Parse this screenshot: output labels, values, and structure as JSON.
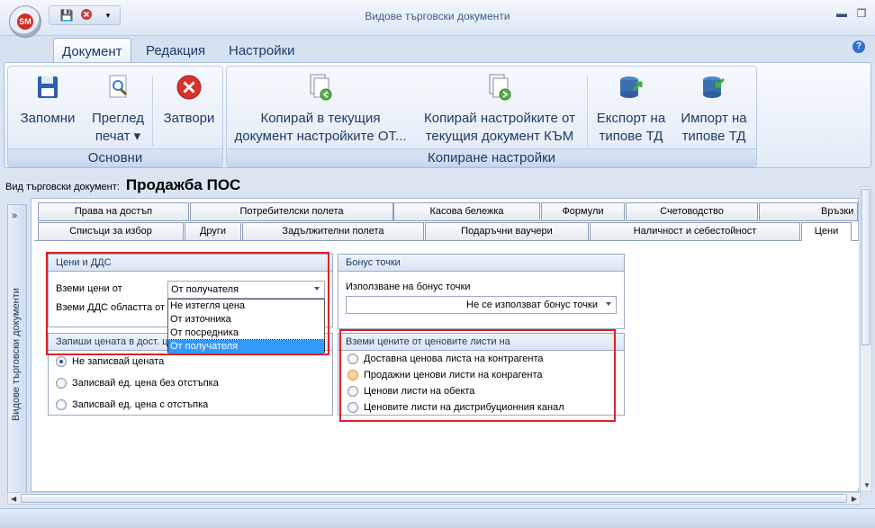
{
  "window": {
    "title": "Видове търговски документи",
    "app_badge": "SM",
    "colors": {
      "accent": "#d42a24",
      "highlight_red": "#e21f26",
      "selection": "#3399ff"
    }
  },
  "qat": {
    "save_icon": "floppy-disk-icon",
    "close_icon": "red-x-icon",
    "more": "▾"
  },
  "window_controls": {
    "minimize": "▬",
    "restore": "❐"
  },
  "ribbon_tabs": [
    {
      "label": "Документ",
      "active": true
    },
    {
      "label": "Редакция",
      "active": false
    },
    {
      "label": "Настройки",
      "active": false
    }
  ],
  "help": "?",
  "ribbon": {
    "groups": [
      {
        "label": "Основни",
        "buttons": [
          {
            "line1": "Запомни",
            "line2": "",
            "icon": "floppy-disk-icon"
          },
          {
            "line1": "Преглед",
            "line2": "печат ▾",
            "icon": "print-preview-icon"
          },
          {
            "line1": "Затвори",
            "line2": "",
            "icon": "red-x-circle-icon"
          }
        ]
      },
      {
        "label": "Копиране настройки",
        "buttons": [
          {
            "line1": "Копирай в текущия",
            "line2": "документ настройките ОТ...",
            "icon": "copy-from-icon"
          },
          {
            "line1": "Копирай настройките от",
            "line2": "текущия документ КЪМ",
            "icon": "copy-to-icon"
          },
          {
            "line1": "Експорт на",
            "line2": "типове ТД",
            "icon": "database-export-icon"
          },
          {
            "line1": "Импорт на",
            "line2": "типове ТД",
            "icon": "database-import-icon"
          }
        ]
      }
    ]
  },
  "doc_type": {
    "label": "Вид търговски документ:",
    "value": "Продажба ПОС"
  },
  "side_panel": {
    "chevron": "»",
    "label": "Видове търговски документи"
  },
  "tabs_row1": [
    "Права на достъп",
    "Потребителски полета",
    "Касова бележка",
    "Формули",
    "Счетоводство",
    "Връзки с"
  ],
  "tabs_row2": [
    "Списъци за избор",
    "Други",
    "Задължителни полета",
    "Подаръчни ваучери",
    "Наличност и себестойност",
    "Цени"
  ],
  "prices_vat": {
    "header": "Цени и ДДС",
    "take_prices_label": "Вземи цени от",
    "take_prices_value": "От получателя",
    "take_vat_label": "Вземи ДДС областта от",
    "dropdown_options": [
      "Не изтегля цена",
      "От източника",
      "От посредника",
      "От получателя"
    ]
  },
  "bonus": {
    "header": "Бонус точки",
    "usage_label": "Използване на бонус точки",
    "usage_value": "Не се използват бонус точки"
  },
  "record_price": {
    "header": "Запиши цената в дост. ц",
    "options": [
      "Не записвай цената",
      "Записвай ед. цена без отстъпка",
      "Записвай ед. цена с отстъпка"
    ],
    "selected": 0
  },
  "price_lists": {
    "header": "Вземи цените от ценовите листи на",
    "options": [
      "Доставна ценова листа на контрагента",
      "Продажни ценови листи на конрагента",
      "Ценови листи на обекта",
      "Ценовите листи на дистрибуционния канал"
    ],
    "hovered": 1
  }
}
